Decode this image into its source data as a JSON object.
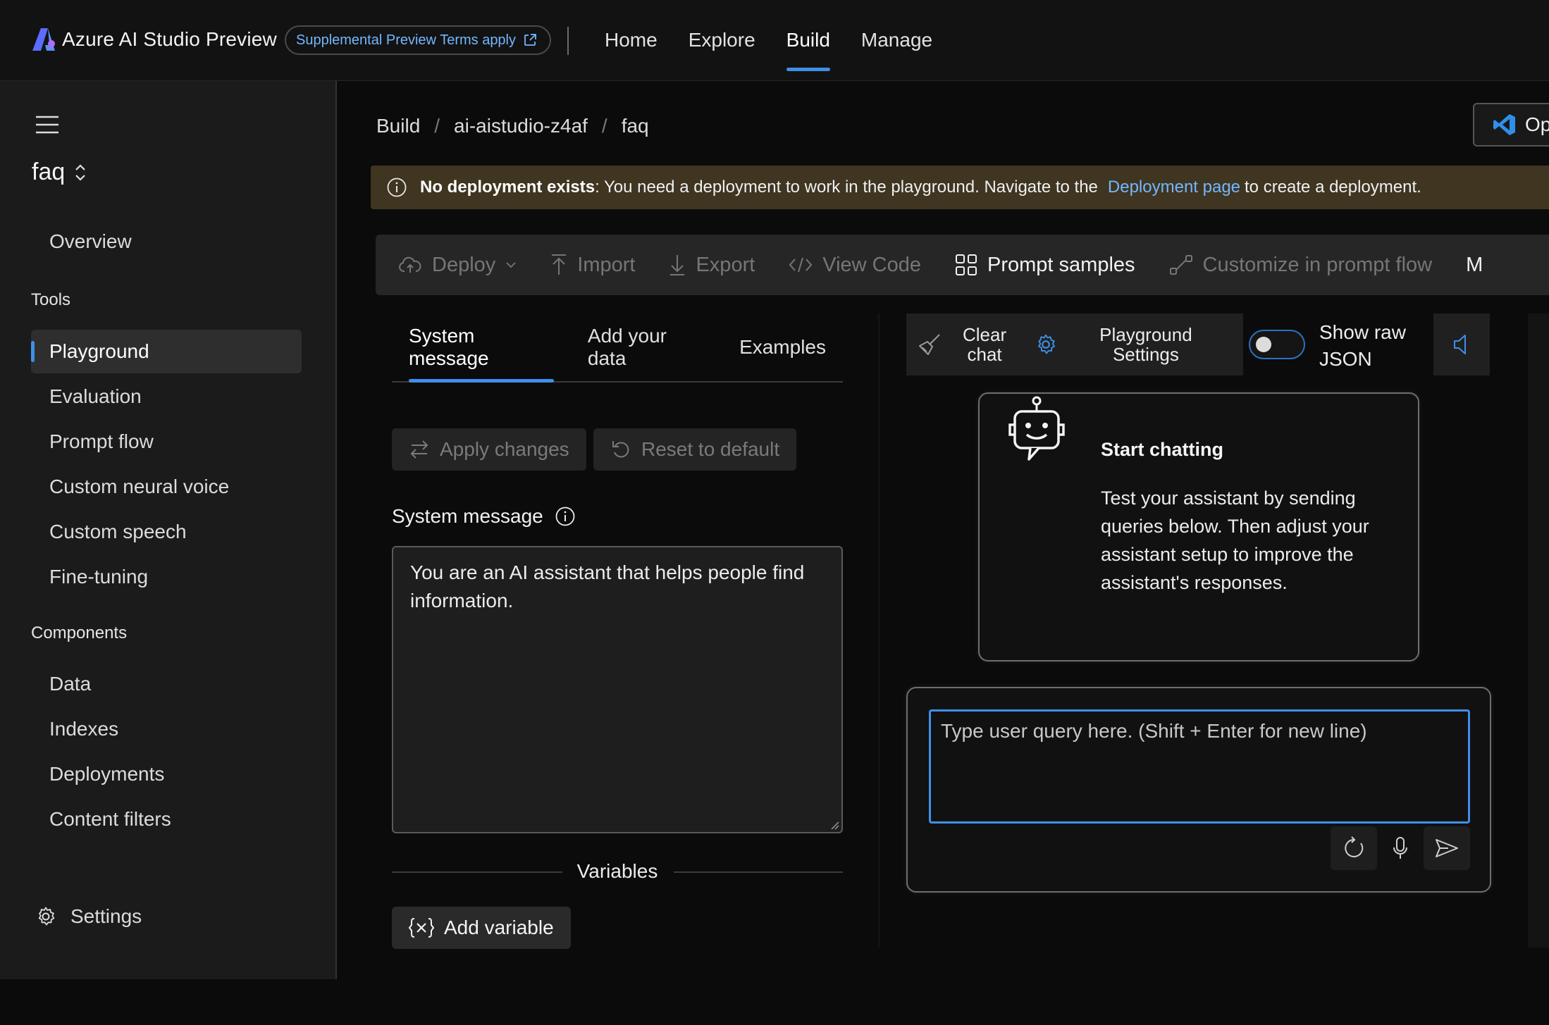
{
  "header": {
    "app_title": "Azure AI Studio Preview",
    "preview_badge": "Supplemental Preview Terms apply",
    "nav": [
      {
        "label": "Home"
      },
      {
        "label": "Explore"
      },
      {
        "label": "Build"
      },
      {
        "label": "Manage"
      }
    ],
    "active_nav": "Build"
  },
  "sidebar": {
    "project": "faq",
    "overview": "Overview",
    "tools_heading": "Tools",
    "tools": [
      {
        "label": "Playground"
      },
      {
        "label": "Evaluation"
      },
      {
        "label": "Prompt flow"
      },
      {
        "label": "Custom neural voice"
      },
      {
        "label": "Custom speech"
      },
      {
        "label": "Fine-tuning"
      }
    ],
    "components_heading": "Components",
    "components": [
      {
        "label": "Data"
      },
      {
        "label": "Indexes"
      },
      {
        "label": "Deployments"
      },
      {
        "label": "Content filters"
      }
    ],
    "settings": "Settings"
  },
  "breadcrumb": {
    "items": [
      "Build",
      "ai-aistudio-z4af",
      "faq"
    ],
    "separator": "/"
  },
  "vscode_button": {
    "label": "Op"
  },
  "warning": {
    "bold": "No deployment exists",
    "text": ": You need a deployment to work in the playground. Navigate to the",
    "link": "Deployment page",
    "suffix": "to create a deployment."
  },
  "toolbar": {
    "deploy": "Deploy",
    "import": "Import",
    "export": "Export",
    "view_code": "View Code",
    "prompt_samples": "Prompt samples",
    "customize": "Customize in prompt flow",
    "more": "M"
  },
  "left_panel": {
    "tabs": [
      "System message",
      "Add your data",
      "Examples"
    ],
    "apply_changes": "Apply changes",
    "reset_default": "Reset to default",
    "system_message_label": "System message",
    "system_message_value": "You are an AI assistant that helps people find information.",
    "variables_label": "Variables",
    "add_variable": "Add variable"
  },
  "chat": {
    "clear_chat_1": "Clear",
    "clear_chat_2": "chat",
    "playground_settings_1": "Playground",
    "playground_settings_2": "Settings",
    "show_raw_json_1": "Show raw",
    "show_raw_json_2": "JSON",
    "show_raw_json_on": false,
    "start_title": "Start chatting",
    "start_body": "Test your assistant by sending queries below. Then adjust your assistant setup to improve the assistant's responses.",
    "input_placeholder": "Type user query here. (Shift + Enter for new line)"
  },
  "colors": {
    "accent": "#3f8fe8",
    "link": "#73b7ff",
    "warning_bg": "#3f3521"
  }
}
